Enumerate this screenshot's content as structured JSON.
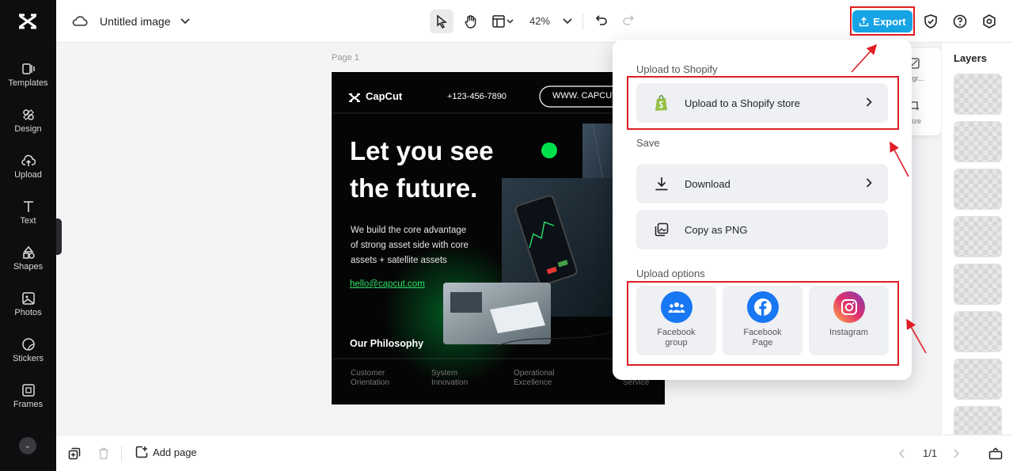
{
  "app": {
    "title": "Untitled image"
  },
  "sidebar": {
    "items": [
      {
        "label": "Templates",
        "icon": "templates-icon"
      },
      {
        "label": "Design",
        "icon": "design-icon"
      },
      {
        "label": "Upload",
        "icon": "upload-cloud-icon"
      },
      {
        "label": "Text",
        "icon": "text-icon"
      },
      {
        "label": "Shapes",
        "icon": "shapes-icon"
      },
      {
        "label": "Photos",
        "icon": "photos-icon"
      },
      {
        "label": "Stickers",
        "icon": "stickers-icon"
      },
      {
        "label": "Frames",
        "icon": "frames-icon"
      }
    ]
  },
  "toolbar": {
    "zoom": "42%",
    "export_label": "Export"
  },
  "canvas": {
    "page_label": "Page 1"
  },
  "poster": {
    "brand": "CapCut",
    "phone": "+123-456-7890",
    "website": "WWW. CAPCUT.",
    "headline_1": "Let you see",
    "headline_2": "the future.",
    "body_1": "We build the core advantage",
    "body_2": "of strong asset side with core",
    "body_3": "assets + satellite assets",
    "email": "hello@capcut.com",
    "philosophy": "Our Philosophy",
    "footer": [
      "Customer Orientation",
      "System Innovation",
      "Operational Excellence",
      "Service"
    ],
    "accent": "#00e24c"
  },
  "export_menu": {
    "shopify_title": "Upload to Shopify",
    "shopify_option": "Upload to a Shopify store",
    "save_title": "Save",
    "download": "Download",
    "copy_png": "Copy as PNG",
    "upload_options_title": "Upload options",
    "cards": [
      {
        "label_1": "Facebook",
        "label_2": "group",
        "color": "#1877f2"
      },
      {
        "label_1": "Facebook",
        "label_2": "Page",
        "color": "#1877f2"
      },
      {
        "label_1": "Instagram",
        "label_2": "",
        "color": "#e1306c"
      }
    ]
  },
  "mini_panel": {
    "label_1": "kgr...",
    "label_2": "size"
  },
  "layers": {
    "title": "Layers"
  },
  "bottombar": {
    "add_page": "Add page",
    "page_counter": "1/1"
  },
  "colors": {
    "highlight": "#e01e24",
    "export": "#16a4e5",
    "shopify": "#95bf47"
  }
}
